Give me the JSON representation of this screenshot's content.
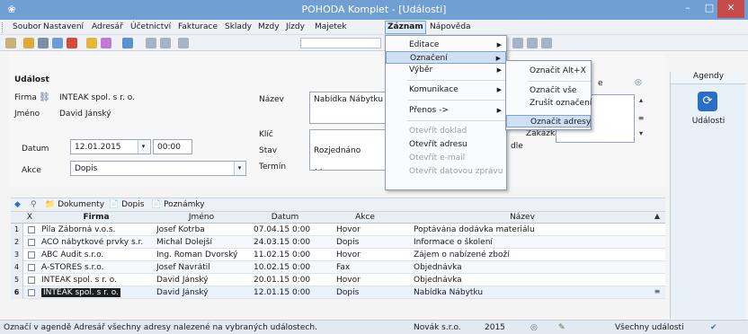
{
  "window": {
    "title": "POHODA Komplet - [Události]",
    "min_glyph": "–",
    "max_glyph": "□",
    "close_glyph": "✕"
  },
  "menubar": [
    "Soubor",
    "Nastavení",
    "Adresář",
    "Účetnictví",
    "Fakturace",
    "Sklady",
    "Mzdy",
    "Jízdy",
    "Majetek",
    "Záznam",
    "Nápověda"
  ],
  "zaznam_menu": {
    "items": [
      {
        "label": "Editace",
        "submenu": true,
        "disabled": false
      },
      {
        "label": "Označení",
        "submenu": true,
        "disabled": false,
        "highlight": true
      },
      {
        "label": "Výběr",
        "submenu": true,
        "disabled": false
      },
      {
        "label": "Komunikace",
        "submenu": true,
        "disabled": false
      },
      {
        "label": "Přenos ->",
        "submenu": true,
        "disabled": false
      },
      {
        "label": "Otevřít doklad",
        "submenu": false,
        "disabled": true
      },
      {
        "label": "Otevřít adresu",
        "submenu": false,
        "disabled": false
      },
      {
        "label": "Otevřít e-mail",
        "submenu": false,
        "disabled": true
      },
      {
        "label": "Otevřít datovou zprávu",
        "submenu": false,
        "disabled": true
      }
    ]
  },
  "oznaceni_submenu": {
    "items": [
      {
        "label": "Označit  Alt+X",
        "highlight": false
      },
      {
        "label": "Označit vše",
        "highlight": false
      },
      {
        "label": "Zrušit označení",
        "highlight": false
      },
      {
        "label": "Označit adresy",
        "highlight": true
      }
    ]
  },
  "form": {
    "section_title": "Událost",
    "firma_label": "Firma",
    "firma_value": "INTEAK spol. s r. o.",
    "jmeno_label": "Jméno",
    "jmeno_value": "David Jánský",
    "datum_label": "Datum",
    "datum_value": "12.01.2015",
    "cas_value": "00:00",
    "akce_label": "Akce",
    "akce_value": "Dopis",
    "nazev_label": "Název",
    "nazev_value": "Nabídka Nábytku",
    "klic_label": "Klíč",
    "stav_label": "Stav",
    "stav_value": "Rozjednáno",
    "termin_label": "Termín",
    "termin_value": ". .",
    "right_partial_label": "dle",
    "right_partial_label2": "Zakázka",
    "right_header_e": "e"
  },
  "agendy": {
    "header": "Agendy",
    "item_label": "Události"
  },
  "tabs": [
    {
      "label": "Dokumenty"
    },
    {
      "label": "Dopis"
    },
    {
      "label": "Poznámky"
    }
  ],
  "grid": {
    "headers": {
      "x": "X",
      "firma": "Firma",
      "jmeno": "Jméno",
      "datum": "Datum",
      "akce": "Akce",
      "nazev": "Název"
    },
    "rows": [
      {
        "n": "1",
        "firma": "Pila Záborná v.o.s.",
        "jmeno": "Josef Kotrba",
        "datum": "07.04.15 0:00",
        "akce": "Hovor",
        "nazev": "Poptávána dodávka materiálu"
      },
      {
        "n": "2",
        "firma": "ACO nábytkové prvky s.r.",
        "jmeno": "Michal Dolejší",
        "datum": "24.03.15 0:00",
        "akce": "Dopis",
        "nazev": "Informace o školení"
      },
      {
        "n": "3",
        "firma": "ABC Audit s.r.o.",
        "jmeno": "Ing. Roman Dvorský",
        "datum": "11.02.15 0:00",
        "akce": "Hovor",
        "nazev": "Zájem o nabízené zboží"
      },
      {
        "n": "4",
        "firma": "A-STORES s.r.o.",
        "jmeno": "Josef Navrátil",
        "datum": "10.02.15 0:00",
        "akce": "Fax",
        "nazev": "Objednávka"
      },
      {
        "n": "5",
        "firma": "INTEAK spol. s r. o.",
        "jmeno": "David Jánský",
        "datum": "20.01.15 0:00",
        "akce": "Hovor",
        "nazev": "Objednávka"
      },
      {
        "n": "6",
        "firma": "INTEAK spol. s r. o.",
        "jmeno": "David Jánský",
        "datum": "12.01.15 0:00",
        "akce": "Dopis",
        "nazev": "Nabídka Nábytku"
      }
    ]
  },
  "statusbar": {
    "message": "Označí v agendě Adresář všechny adresy nalezené na vybraných událostech.",
    "company": "Novák s.r.o.",
    "year": "2015",
    "filter": "Všechny události"
  },
  "colors": {
    "titlebar": "#6f9fd3",
    "close": "#c74a4a",
    "highlight": "#cfe0f4",
    "accent": "#2a6fc3"
  }
}
